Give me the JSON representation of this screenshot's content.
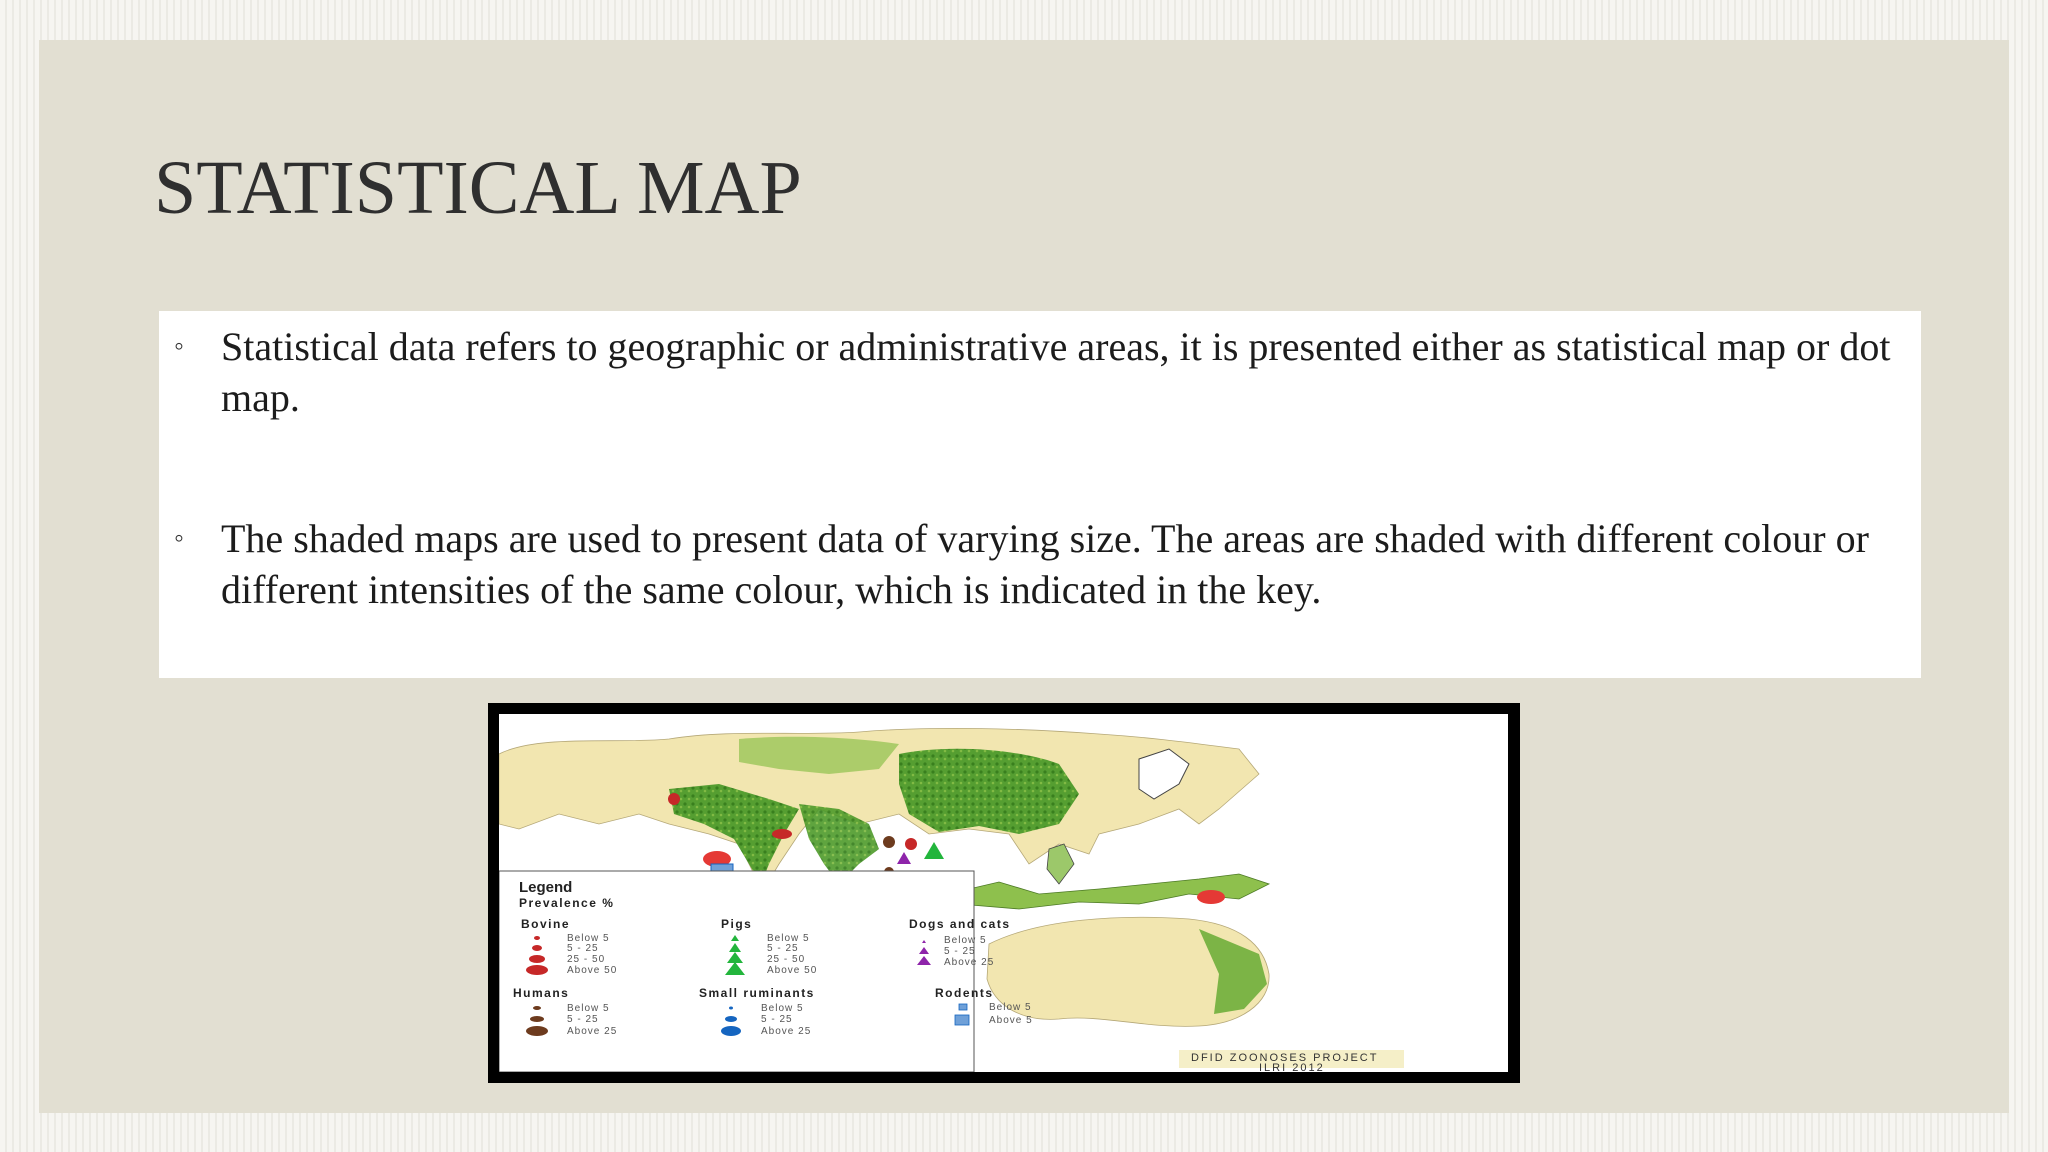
{
  "slide": {
    "title": "STATISTICAL MAP",
    "bullets": [
      {
        "marker": "◦",
        "text": "Statistical data refers to geographic or administrative areas, it is presented either as statistical map or dot map."
      },
      {
        "marker": "◦",
        "text": "The shaded maps are used to present data of varying size. The areas are shaded with different colour or different intensities of the same colour, which is indicated in the key."
      }
    ],
    "colors": {
      "background": "#e2dfd2",
      "title": "#2f2f2f",
      "content_box": "#ffffff"
    }
  },
  "map": {
    "legend": {
      "title": "Legend",
      "subtitle": "Prevalence %",
      "groups": [
        {
          "name": "Bovine",
          "color": "#c62828",
          "symbol": "circle",
          "items": [
            "Below 5",
            "5 - 25",
            "25 - 50",
            "Above 50"
          ]
        },
        {
          "name": "Pigs",
          "color": "#22b53c",
          "symbol": "triangle",
          "items": [
            "Below 5",
            "5 - 25",
            "25 - 50",
            "Above 50"
          ]
        },
        {
          "name": "Dogs and cats",
          "color": "#8e24aa",
          "symbol": "triangle",
          "items": [
            "Below 5",
            "5 - 25",
            "Above 25"
          ]
        },
        {
          "name": "Humans",
          "color": "#6d3b1e",
          "symbol": "circle",
          "items": [
            "Below 5",
            "5 - 25",
            "Above 25"
          ]
        },
        {
          "name": "Small ruminants",
          "color": "#1565c0",
          "symbol": "circle",
          "items": [
            "Below 5",
            "5 - 25",
            "Above 25"
          ]
        },
        {
          "name": "Rodents",
          "color": "#6fa0d8",
          "symbol": "square",
          "items": [
            "Below 5",
            "Above 5"
          ]
        }
      ]
    },
    "credit": {
      "line1": "DFID ZOONOSES PROJECT",
      "line2": "ILRI 2012"
    },
    "colors": {
      "land": "#f2e6b0",
      "vegetation": "#3f8f20",
      "frame": "#000000"
    }
  }
}
